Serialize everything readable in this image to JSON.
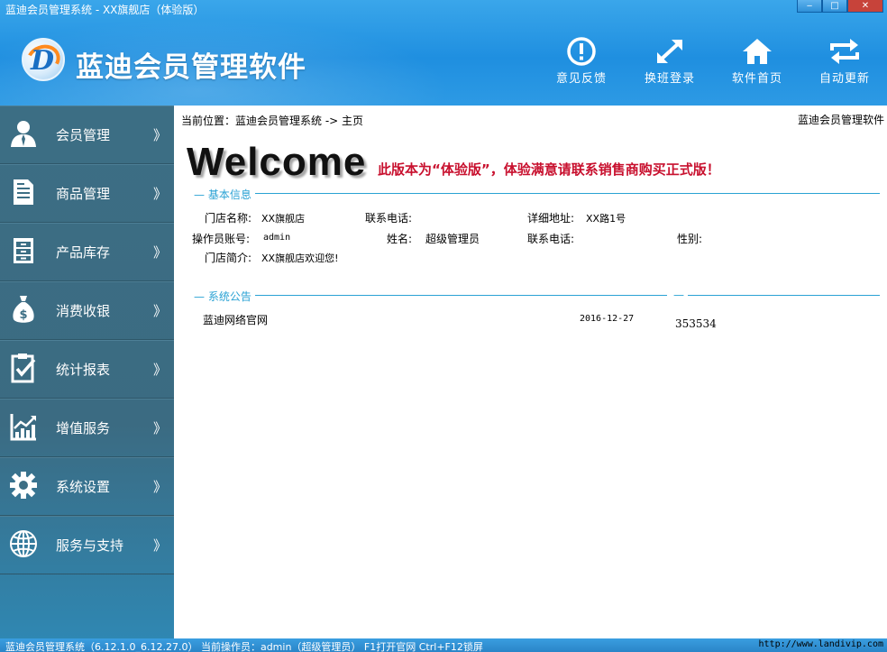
{
  "window": {
    "title": "蓝迪会员管理系统 - XX旗舰店（体验版）",
    "min_label": "‒",
    "max_label": "□",
    "close_label": "✕"
  },
  "header": {
    "app_title": "蓝迪会员管理软件",
    "logo_letter": "D",
    "tools": [
      {
        "label": "意见反馈",
        "icon": "exclamation-circle-icon"
      },
      {
        "label": "换班登录",
        "icon": "expand-arrows-icon"
      },
      {
        "label": "软件首页",
        "icon": "home-icon"
      },
      {
        "label": "自动更新",
        "icon": "refresh-icon"
      }
    ]
  },
  "sidebar": {
    "chevron": "》",
    "items": [
      {
        "label": "会员管理",
        "icon": "user-icon"
      },
      {
        "label": "商品管理",
        "icon": "document-icon"
      },
      {
        "label": "产品库存",
        "icon": "cabinet-icon"
      },
      {
        "label": "消费收银",
        "icon": "money-bag-icon"
      },
      {
        "label": "统计报表",
        "icon": "clipboard-check-icon"
      },
      {
        "label": "增值服务",
        "icon": "chart-up-icon"
      },
      {
        "label": "系统设置",
        "icon": "gear-icon"
      },
      {
        "label": "服务与支持",
        "icon": "globe-icon"
      }
    ]
  },
  "content": {
    "breadcrumb": "当前位置：蓝迪会员管理系统 -> 主页",
    "top_right": "蓝迪会员管理软件",
    "welcome": "Welcome",
    "trial_notice": "此版本为“体验版”，体验满意请联系销售商购买正式版！",
    "basic_info": {
      "heading": "— 基本信息",
      "store_name_label": "门店名称:",
      "store_name_value": "XX旗舰店",
      "phone_label": "联系电话:",
      "phone_value": "",
      "address_label": "详细地址:",
      "address_value": "XX路1号",
      "operator_label": "操作员账号:",
      "operator_value": "admin",
      "name_label": "姓名:",
      "name_value": "超级管理员",
      "phone2_label": "联系电话:",
      "phone2_value": "",
      "gender_label": "性别:",
      "gender_value": "",
      "intro_label": "门店简介:",
      "intro_value": "XX旗舰店欢迎您!"
    },
    "announcements": {
      "heading": "— 系统公告",
      "side_heading": "—",
      "items": [
        {
          "title": "蓝迪网络官网",
          "date": "2016-12-27"
        }
      ],
      "side_value": "353534"
    }
  },
  "statusbar": {
    "left": "蓝迪会员管理系统（6.12.1.0_6.12.27.0） 当前操作员：admin（超级管理员） F1打开官网 Ctrl+F12锁屏",
    "right": "http://www.landivip.com"
  }
}
